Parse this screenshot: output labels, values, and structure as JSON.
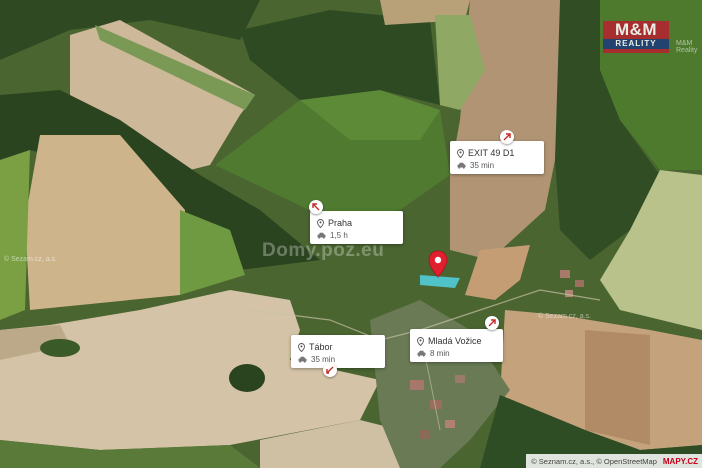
{
  "logo": {
    "top": "M&M",
    "bottom": "REALITY"
  },
  "watermarks": {
    "small": "© Sezam.cz, a.s.",
    "big": "Domy.poz.eu",
    "corner": "M&M Reality"
  },
  "destinations": [
    {
      "name": "EXIT 49 D1",
      "time": "35 min"
    },
    {
      "name": "Praha",
      "time": "1,5 h"
    },
    {
      "name": "Tábor",
      "time": "35 min"
    },
    {
      "name": "Mladá Vožice",
      "time": "8 min"
    }
  ],
  "attribution": {
    "text": "© Seznam.cz, a.s., © OpenStreetMap",
    "brand": "MAPY.CZ"
  },
  "colors": {
    "pin": "#e0202f",
    "card_bg": "#ffffff",
    "logo_red": "#b3242e",
    "logo_blue": "#1d3c7a"
  }
}
